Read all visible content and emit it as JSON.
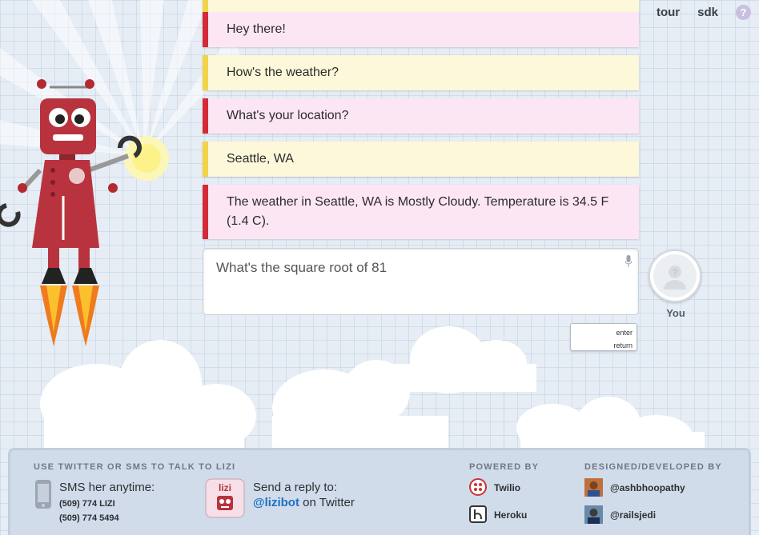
{
  "nav": {
    "tour": "tour",
    "sdk": "sdk",
    "help": "?"
  },
  "messages": [
    {
      "role": "robot",
      "text": ""
    },
    {
      "role": "robot",
      "text": "Hey there!"
    },
    {
      "role": "user",
      "text": "How's the weather?"
    },
    {
      "role": "robot",
      "text": "What's your location?"
    },
    {
      "role": "user",
      "text": "Seattle, WA"
    },
    {
      "role": "robot",
      "text": "The weather in Seattle, WA is Mostly Cloudy. Temperature is 34.5 F (1.4 C)."
    }
  ],
  "composer": {
    "value": "What's the square root of 81",
    "enter_label": "enter",
    "return_label": "return"
  },
  "user": {
    "label": "You"
  },
  "footer": {
    "contact_heading": "USE TWITTER OR SMS TO TALK TO LIZI",
    "sms_title": "SMS her anytime:",
    "sms_numbers": [
      "(509) 774 LIZI",
      "(509) 774 5494"
    ],
    "reply_title": "Send a reply to:",
    "twitter_handle": "@lizibot",
    "twitter_suffix": " on Twitter",
    "lizi_logo_text": "lizi",
    "powered_heading": "POWERED BY",
    "powered_by": [
      "Twilio",
      "Heroku"
    ],
    "designed_heading": "DESIGNED/DEVELOPED BY",
    "developers": [
      "@ashbhoopathy",
      "@railsjedi"
    ]
  },
  "colors": {
    "robot_accent": "#d42a37",
    "user_accent": "#f1d44a",
    "robot_bubble": "#fde6f3",
    "user_bubble": "#fdf8da",
    "link": "#1f6fc1"
  }
}
